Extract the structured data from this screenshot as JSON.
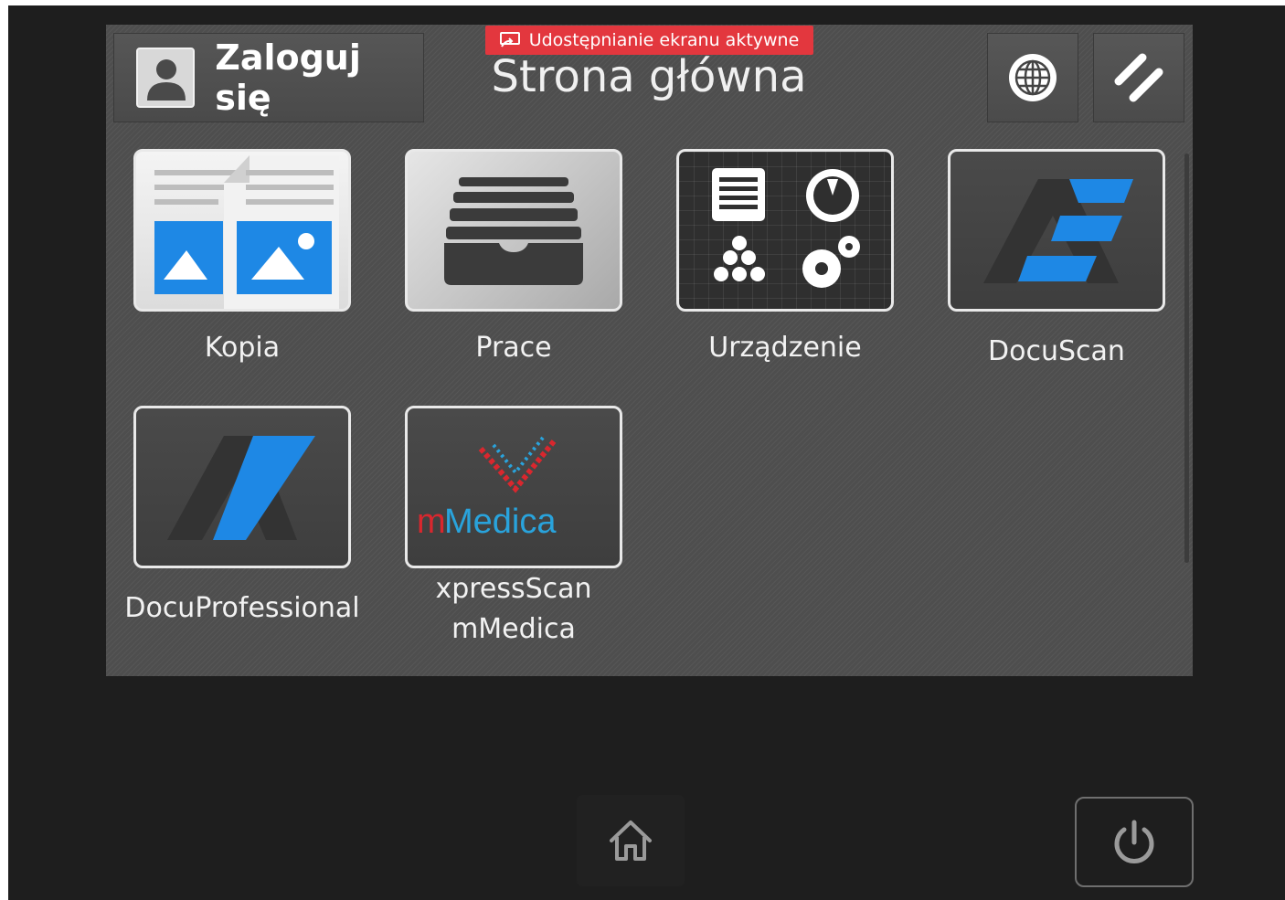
{
  "header": {
    "login_label": "Zaloguj się",
    "page_title": "Strona główna",
    "share_badge": "Udostępnianie ekranu aktywne"
  },
  "apps": [
    {
      "label": "Kopia",
      "icon": "copy-icon"
    },
    {
      "label": "Prace",
      "icon": "jobs-icon"
    },
    {
      "label": "Urządzenie",
      "icon": "device-icon"
    },
    {
      "label": "DocuScan",
      "icon": "docuscan-logo-icon"
    },
    {
      "label": "DocuProfessional",
      "icon": "docuprofessional-logo-icon"
    },
    {
      "label": "xpressScan\nmMedica",
      "icon": "mmedica-logo-icon",
      "logo_text_1": "m",
      "logo_text_2": "Medica"
    }
  ],
  "colors": {
    "accent_blue": "#1e88e5",
    "badge_red": "#e3373e",
    "mmedica_red": "#d9272e",
    "mmedica_blue": "#29a3dc"
  }
}
